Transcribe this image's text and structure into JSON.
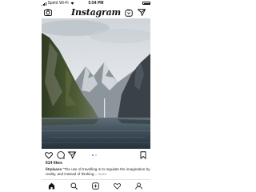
{
  "status_bar": {
    "carrier": "Sprint Wi-Fi",
    "time": "5:54 PM",
    "battery_icon": "battery-icon",
    "signal_icon": "signal-icon",
    "wifi_icon": "wifi-icon"
  },
  "header": {
    "logo_text": "Instagram",
    "camera_icon": "camera-icon",
    "igtv_icon": "igtv-icon",
    "direct_icon": "direct-message-icon"
  },
  "post": {
    "image_icon": "fjord-landscape-photo",
    "carousel_dots": 2,
    "carousel_active": 0,
    "likes": "614 likes",
    "username": "litrplaces",
    "caption": "“The use of travelling is to regulate the imagination by reality, and instead of thinking...",
    "more_label": "more"
  },
  "actions": {
    "like_icon": "heart-icon",
    "comment_icon": "comment-icon",
    "share_icon": "paper-plane-icon",
    "save_icon": "bookmark-icon"
  },
  "bottom_nav": {
    "items": [
      "home-icon",
      "search-icon",
      "add-post-icon",
      "activity-heart-icon",
      "profile-icon"
    ]
  },
  "colors": {
    "accent": "#3897f0",
    "text": "#262626",
    "muted": "#8e8e8e"
  }
}
